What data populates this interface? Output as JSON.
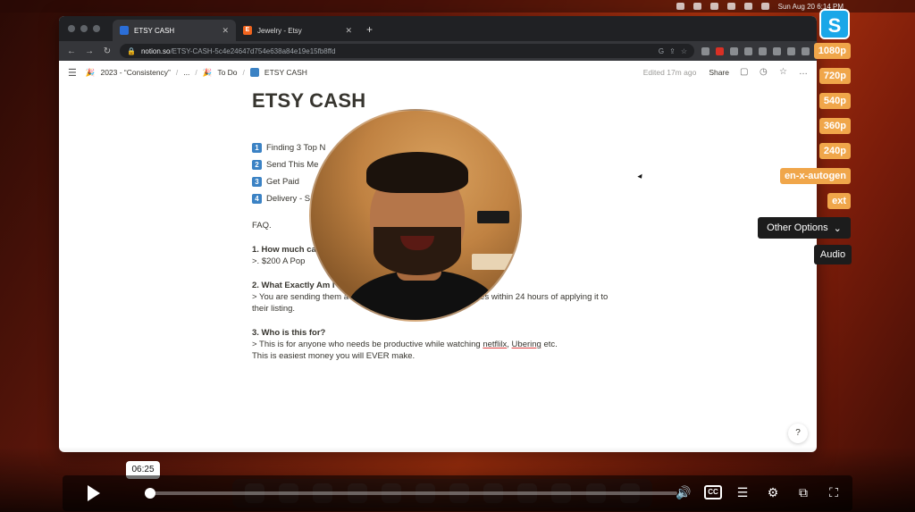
{
  "browser": {
    "tabs": [
      {
        "label": "ETSY CASH",
        "active": true
      },
      {
        "label": "Jewelry - Etsy",
        "active": false
      }
    ],
    "address": {
      "host": "notion.so",
      "path": "/ETSY-CASH-5c4e24647d754e638a84e19e15fb8ffd"
    }
  },
  "mac": {
    "clock": "Sun Aug 20  6:14 PM"
  },
  "notion": {
    "breadcrumbs": [
      "2023 - “Consistency”",
      "...",
      "To Do",
      "ETSY CASH"
    ],
    "edited": "Edited 17m ago",
    "share": "Share",
    "title": "ETSY CASH",
    "steps": [
      {
        "num": "1",
        "text": "Finding 3 Top N"
      },
      {
        "num": "2",
        "text": "Send This Me"
      },
      {
        "num": "3",
        "text": "Get Paid"
      },
      {
        "num": "4",
        "text": "Delivery - S"
      }
    ],
    "faq_label": "FAQ.",
    "q1": "1.  How much can",
    "a1": ">. $200 A Pop",
    "q2": "2. What Exactly Am I selling",
    "a2_line1": ">  You are sending them a Video and a Software to Boost Sales within 24 hours of applying it to",
    "a2_line2": "their listing.",
    "q3": "3. Who is this for?",
    "a3_pre": "> This is for anyone who needs be productive while watching ",
    "a3_netflix": "netflilx",
    "a3_mid": ", ",
    "a3_ubering": "Ubering",
    "a3_post": " etc.",
    "a3_line2": "This is easiest money you will EVER make.",
    "help": "?"
  },
  "overlay": {
    "brand_letter": "S",
    "qualities": [
      "1080p",
      "720p",
      "540p",
      "360p",
      "240p",
      "en-x-autogen",
      "ext"
    ],
    "other_options": "Other Options",
    "audio": "Audio"
  },
  "player": {
    "time_tooltip": "06:25",
    "progress": 0.01
  },
  "colors": {
    "quality_bg": "#f0a64a",
    "brand_bg": "#1aa7e8",
    "notion_blue": "#3b82c4"
  }
}
